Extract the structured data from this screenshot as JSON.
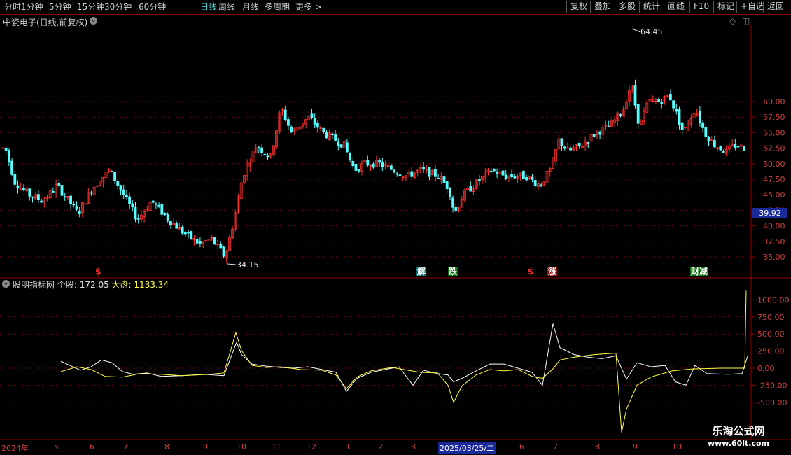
{
  "toolbar": {
    "left": [
      "分时",
      "1分钟",
      "5分钟",
      "15分钟",
      "30分钟",
      "60分钟",
      "日线",
      "周线",
      "月线",
      "多周期",
      "更多 >"
    ],
    "active_index": 6,
    "right": [
      "复权",
      "叠加",
      "多股",
      "统计",
      "画线",
      "F10",
      "+自选",
      "返回"
    ],
    "right_extra": "标记"
  },
  "main_panel": {
    "title": "中瓷电子(日线,前复权)",
    "high_label": "64.45",
    "low_label": "34.15",
    "current_price": "39.92",
    "y_ticks": [
      "60.00",
      "57.50",
      "55.00",
      "52.50",
      "50.00",
      "47.50",
      "45.00",
      "42.50",
      "40.00",
      "37.50",
      "35.00"
    ],
    "signals": [
      {
        "text": "$",
        "color": "#ff3030",
        "bg": "none"
      },
      {
        "text": "解",
        "color": "#ffffff",
        "bg": "#0a6e6e"
      },
      {
        "text": "跌",
        "color": "#ffffff",
        "bg": "#0a6e0a"
      },
      {
        "text": "$",
        "color": "#ff3030",
        "bg": "none"
      },
      {
        "text": "涨",
        "color": "#ffffff",
        "bg": "#8b1010"
      },
      {
        "text": "财减",
        "color": "#ffffff",
        "bg": "#0a6e0a"
      }
    ]
  },
  "indicator_panel": {
    "name": "股朋指标网",
    "stock_label": "个股:",
    "stock_value": "172.05",
    "market_label": "大盘:",
    "market_value": "1133.34",
    "y_ticks": [
      "1000.00",
      "750.00",
      "500.00",
      "250.00",
      "0.00",
      "-250.00",
      "-500.00"
    ]
  },
  "date_axis": [
    "2024年",
    "5",
    "6",
    "7",
    "8",
    "9",
    "10",
    "11",
    "12",
    "1",
    "2",
    "3",
    "2025/03/25/二",
    "6",
    "7",
    "8",
    "9",
    "10"
  ],
  "watermark": {
    "line1": "乐淘公式网",
    "line2": "www.60lt.com"
  },
  "colors": {
    "up": "#ff3030",
    "down": "#54ffff",
    "grid": "#8b0000",
    "stock_line": "#ffffff",
    "market_line": "#ffff40",
    "axis_text": "#d04040"
  }
}
